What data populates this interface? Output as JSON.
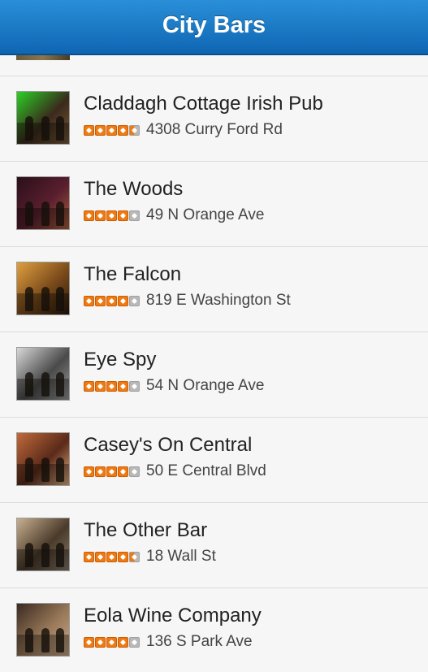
{
  "header": {
    "title": "City Bars"
  },
  "bars": [
    {
      "name": "Claddagh Cottage Irish Pub",
      "address": "4308 Curry Ford Rd",
      "rating": 4.5,
      "thumb": "pub-thumb",
      "colors": [
        "#2bd125",
        "#3a2a1c",
        "#7a5a3a"
      ]
    },
    {
      "name": "The Woods",
      "address": "49 N Orange Ave",
      "rating": 4,
      "thumb": "woods-thumb",
      "colors": [
        "#2a0f1a",
        "#5a1f2f",
        "#b0603a"
      ]
    },
    {
      "name": "The Falcon",
      "address": "819 E Washington St",
      "rating": 4,
      "thumb": "falcon-thumb",
      "colors": [
        "#e0a040",
        "#7a4a1a",
        "#2a1a0c"
      ]
    },
    {
      "name": "Eye Spy",
      "address": "54 N Orange Ave",
      "rating": 4,
      "thumb": "eyespy-thumb",
      "colors": [
        "#d8d8d8",
        "#4a4a4a",
        "#9a9a9a"
      ]
    },
    {
      "name": "Casey's On Central",
      "address": "50 E Central Blvd",
      "rating": 4,
      "thumb": "caseys-thumb",
      "colors": [
        "#c06a3a",
        "#5a2a1a",
        "#e8b080"
      ]
    },
    {
      "name": "The Other Bar",
      "address": "18 Wall St",
      "rating": 4.5,
      "thumb": "otherbar-thumb",
      "colors": [
        "#c8b090",
        "#4a3a2a",
        "#8a7a6a"
      ]
    },
    {
      "name": "Eola Wine Company",
      "address": "136 S Park Ave",
      "rating": 4,
      "thumb": "eola-thumb",
      "colors": [
        "#3a2a20",
        "#9a7a5a",
        "#c8a888"
      ]
    }
  ]
}
